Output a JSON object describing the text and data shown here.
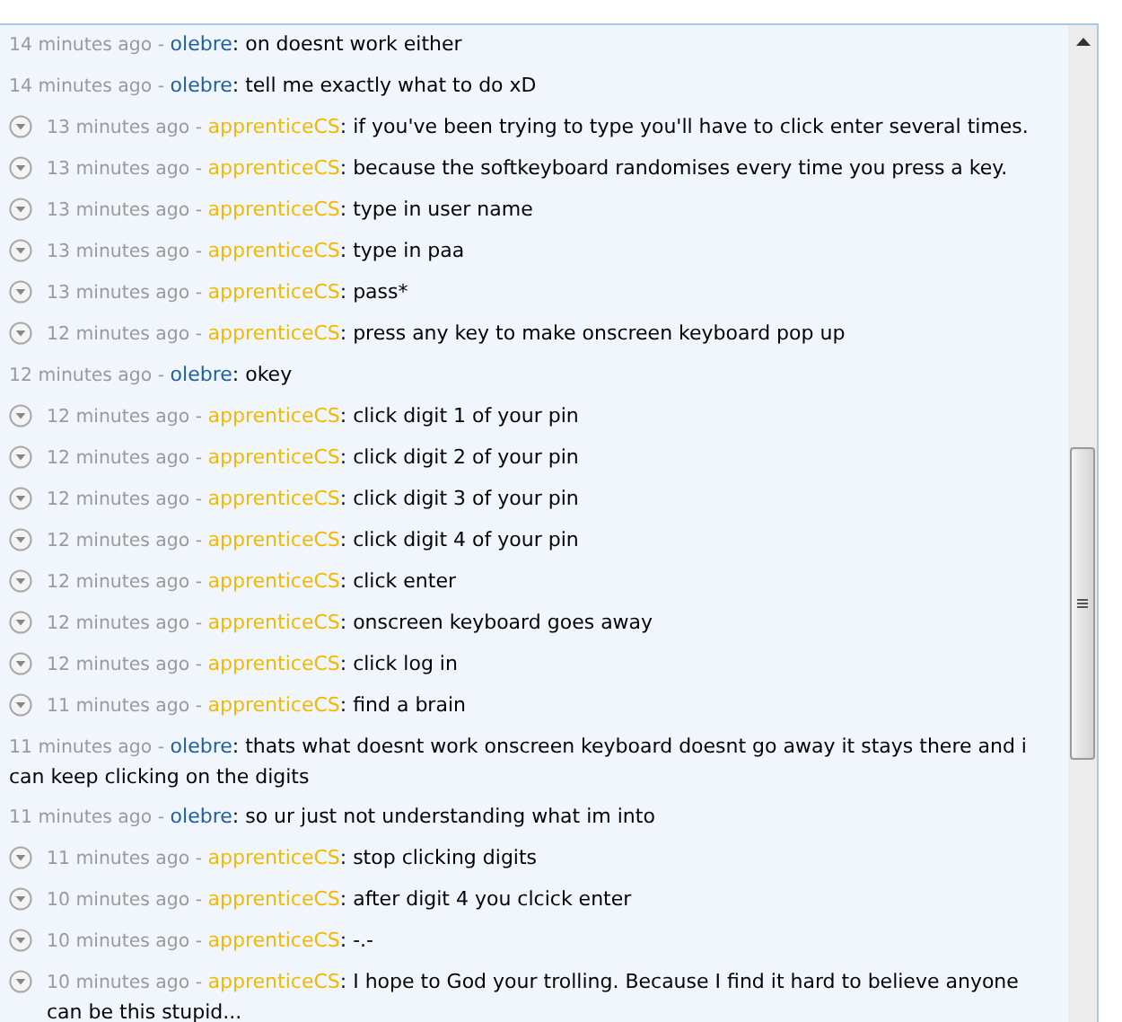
{
  "messages": [
    {
      "collapsible": false,
      "time": "14 minutes ago -",
      "author": "olebre",
      "color": "#1f5fa6",
      "text": ": on doesnt work either"
    },
    {
      "collapsible": false,
      "time": "14 minutes ago -",
      "author": "olebre",
      "color": "#1f5fa6",
      "text": ": tell me exactly what to do xD"
    },
    {
      "collapsible": true,
      "time": "13 minutes ago -",
      "author": "apprenticeCS",
      "color": "#f5b800",
      "text": ": if you've been trying to type you'll have to click enter several times."
    },
    {
      "collapsible": true,
      "time": "13 minutes ago -",
      "author": "apprenticeCS",
      "color": "#f5b800",
      "text": ": because the softkeyboard randomises every time you press a key."
    },
    {
      "collapsible": true,
      "time": "13 minutes ago -",
      "author": "apprenticeCS",
      "color": "#f5b800",
      "text": ": type in user name"
    },
    {
      "collapsible": true,
      "time": "13 minutes ago -",
      "author": "apprenticeCS",
      "color": "#f5b800",
      "text": ": type in paa"
    },
    {
      "collapsible": true,
      "time": "13 minutes ago -",
      "author": "apprenticeCS",
      "color": "#f5b800",
      "text": ": pass*"
    },
    {
      "collapsible": true,
      "time": "12 minutes ago -",
      "author": "apprenticeCS",
      "color": "#f5b800",
      "text": ": press any key to make onscreen keyboard pop up"
    },
    {
      "collapsible": false,
      "time": "12 minutes ago -",
      "author": "olebre",
      "color": "#1f5fa6",
      "text": ": okey"
    },
    {
      "collapsible": true,
      "time": "12 minutes ago -",
      "author": "apprenticeCS",
      "color": "#f5b800",
      "text": ": click digit 1 of your pin"
    },
    {
      "collapsible": true,
      "time": "12 minutes ago -",
      "author": "apprenticeCS",
      "color": "#f5b800",
      "text": ": click digit 2 of your pin"
    },
    {
      "collapsible": true,
      "time": "12 minutes ago -",
      "author": "apprenticeCS",
      "color": "#f5b800",
      "text": ": click digit 3 of your pin"
    },
    {
      "collapsible": true,
      "time": "12 minutes ago -",
      "author": "apprenticeCS",
      "color": "#f5b800",
      "text": ": click digit 4 of your pin"
    },
    {
      "collapsible": true,
      "time": "12 minutes ago -",
      "author": "apprenticeCS",
      "color": "#f5b800",
      "text": ": click enter"
    },
    {
      "collapsible": true,
      "time": "12 minutes ago -",
      "author": "apprenticeCS",
      "color": "#f5b800",
      "text": ": onscreen keyboard goes away"
    },
    {
      "collapsible": true,
      "time": "12 minutes ago -",
      "author": "apprenticeCS",
      "color": "#f5b800",
      "text": ": click log in"
    },
    {
      "collapsible": true,
      "time": "11 minutes ago -",
      "author": "apprenticeCS",
      "color": "#f5b800",
      "text": ": find a brain"
    },
    {
      "collapsible": false,
      "time": "11 minutes ago -",
      "author": "olebre",
      "color": "#1f5fa6",
      "text": ": thats what doesnt work onscreen keyboard doesnt go away it stays there and i can keep clicking on the digits"
    },
    {
      "collapsible": false,
      "time": "11 minutes ago -",
      "author": "olebre",
      "color": "#1f5fa6",
      "text": ": so ur just not understanding what im into"
    },
    {
      "collapsible": true,
      "time": "11 minutes ago -",
      "author": "apprenticeCS",
      "color": "#f5b800",
      "text": ": stop clicking digits"
    },
    {
      "collapsible": true,
      "time": "10 minutes ago -",
      "author": "apprenticeCS",
      "color": "#f5b800",
      "text": ": after digit 4 you clcick enter"
    },
    {
      "collapsible": true,
      "time": "10 minutes ago -",
      "author": "apprenticeCS",
      "color": "#f5b800",
      "text": ": -.-"
    },
    {
      "collapsible": true,
      "time": "10 minutes ago -",
      "author": "apprenticeCS",
      "color": "#f5b800",
      "text": ": I hope to God your trolling. Because I find it hard to believe anyone can be this stupid..."
    }
  ]
}
